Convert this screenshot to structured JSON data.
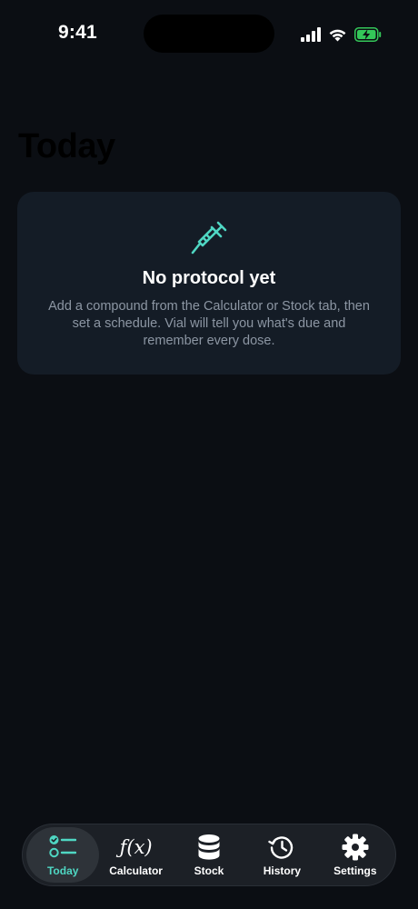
{
  "status_bar": {
    "time": "9:41"
  },
  "page": {
    "title": "Today"
  },
  "empty_state": {
    "icon": "syringe-icon",
    "title": "No protocol yet",
    "body": "Add a compound from the Calculator or Stock tab, then set a schedule. Vial will tell you what's due and remember every dose."
  },
  "tab_bar": {
    "tabs": [
      {
        "label": "Today",
        "icon": "checklist-icon",
        "active": true
      },
      {
        "label": "Calculator",
        "icon": "function-icon",
        "glyph": "ƒ(x)",
        "active": false
      },
      {
        "label": "Stock",
        "icon": "database-icon",
        "active": false
      },
      {
        "label": "History",
        "icon": "history-clock-icon",
        "active": false
      },
      {
        "label": "Settings",
        "icon": "gear-icon",
        "active": false
      }
    ]
  },
  "colors": {
    "background": "#0b0e13",
    "card": "#141c26",
    "accent": "#4fd7c3",
    "battery": "#34c759",
    "muted_text": "#8c96a3"
  }
}
